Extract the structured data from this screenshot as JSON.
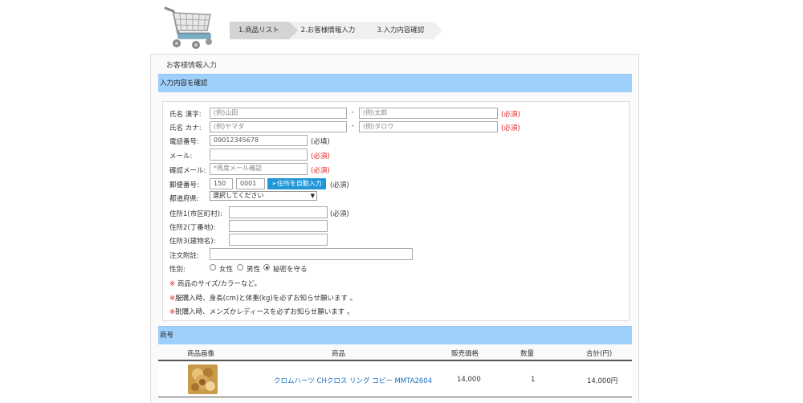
{
  "steps": [
    "1.商品リスト",
    "2.お客様情報入力",
    "3.入力内容確認"
  ],
  "panel_title": "お客様情報入力",
  "section_confirm": "入力内容を確認",
  "form": {
    "name_kanji_label": "氏名 漢字:",
    "last_kanji_placeholder": "(例)山田",
    "first_kanji_placeholder": "(例)太郎",
    "name_kana_label": "氏名 カナ:",
    "last_kana_placeholder": "(例)ヤマダ",
    "first_kana_placeholder": "(例)タロウ",
    "dash": "-",
    "required_red": "(必須)",
    "required_black": "(必填)",
    "required_black2": "(必須)",
    "phone_label": "電話番号:",
    "phone_value": "09012345678",
    "email_label": "メール:",
    "confirm_email_label": "確認メール:",
    "confirm_email_placeholder": "*再度メール確認",
    "zip_label": "郵便番号:",
    "zip1_value": "150",
    "zip2_value": "0001",
    "auto_address_button": "➢住所を自動入力",
    "prefecture_label": "都道府県:",
    "prefecture_selected": "選択してください",
    "address1_label": "住所1(市区町村):",
    "address2_label": "住所2(丁番地):",
    "address3_label": "住所3(建物名):",
    "order_note_label": "注文附註:",
    "gender_label": "性別:",
    "gender_options": [
      "女性",
      "男性",
      "秘密を守る"
    ],
    "notes": [
      {
        "mark": "※",
        "text": " 商品のサイズ/カラーなど。"
      },
      {
        "mark": "※",
        "text": "服購入時、身長(cm)と体重(kg)を必ずお知らせ願います 。"
      },
      {
        "mark": "※",
        "text": "靴購入時、メンズかレディースを必ずお知らせ願います 。"
      }
    ]
  },
  "section_product": "商号",
  "table": {
    "headers": [
      "商品画像",
      "商品",
      "販売価格",
      "数量",
      "合計(円)"
    ],
    "rows": [
      {
        "product": "クロムハーツ CHクロス リング コピー MMTA2604",
        "price": "14,000",
        "qty": "1",
        "total": "14,000円"
      }
    ]
  }
}
